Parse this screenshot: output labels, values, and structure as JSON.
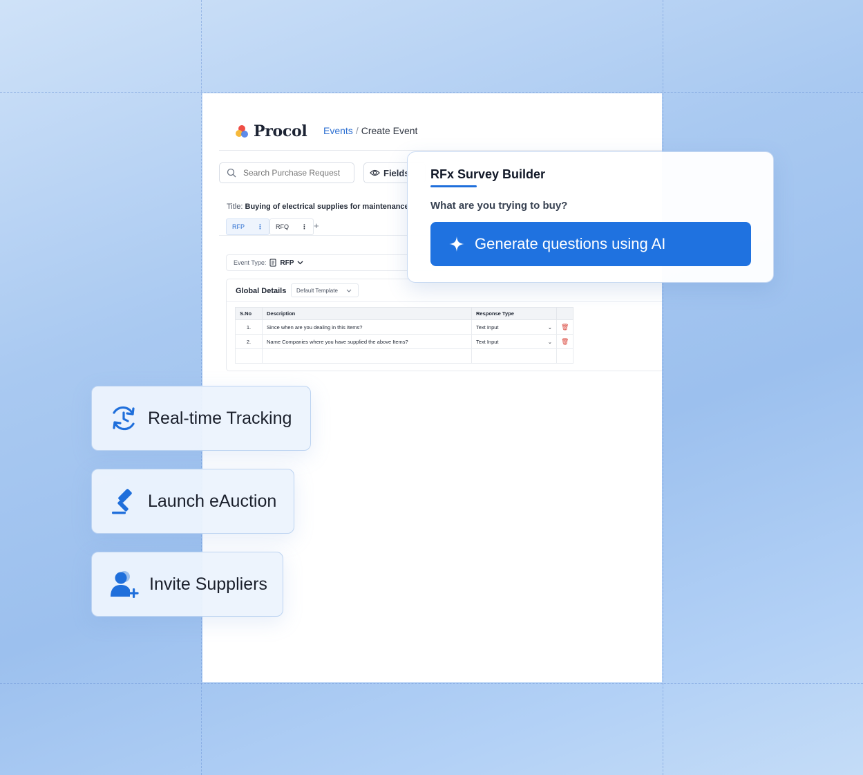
{
  "app": {
    "brand": "Procol"
  },
  "breadcrumb": {
    "parent": "Events",
    "separator": "/",
    "current": "Create Event"
  },
  "toolbar": {
    "search_placeholder": "Search Purchase Request",
    "fields_label": "Fields"
  },
  "event": {
    "title_label": "Title:",
    "title_value": "Buying of electrical supplies for maintenance",
    "tabs": [
      {
        "label": "RFP",
        "active": true
      },
      {
        "label": "RFQ",
        "active": false
      }
    ],
    "add_tab_label": "+",
    "type_label": "Event Type:",
    "type_value": "RFP"
  },
  "global_details": {
    "title": "Global Details",
    "template": "Default Template",
    "columns": [
      "S.No",
      "Description",
      "Response Type"
    ],
    "rows": [
      {
        "sno": "1.",
        "description": "Since when are you dealing in this Items?",
        "response": "Text Input"
      },
      {
        "sno": "2.",
        "description": "Name Companies where you have supplied the above Items?",
        "response": "Text Input"
      }
    ]
  },
  "survey": {
    "title": "RFx Survey Builder",
    "question": "What are you trying to buy?",
    "button_label": "Generate questions using AI",
    "accent_color": "#1f72e0"
  },
  "features": [
    {
      "label": "Real-time Tracking",
      "icon": "clock-refresh-icon"
    },
    {
      "label": "Launch eAuction",
      "icon": "gavel-icon"
    },
    {
      "label": "Invite Suppliers",
      "icon": "user-plus-icon"
    }
  ]
}
